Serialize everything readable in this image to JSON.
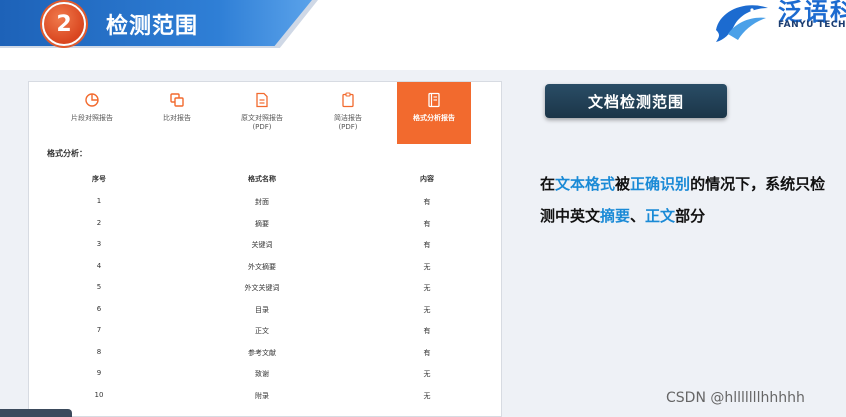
{
  "header": {
    "number": "2",
    "title": "检测范围"
  },
  "logo": {
    "cn": "泛语科",
    "en": "FANYU TECHNOL"
  },
  "tabs": [
    {
      "label": "片段对照报告",
      "icon": "pie-chart-icon"
    },
    {
      "label": "比对报告",
      "icon": "copy-icon"
    },
    {
      "label": "原文对照报告\n(PDF)",
      "icon": "document-icon"
    },
    {
      "label": "简洁报告\n(PDF)",
      "icon": "clipboard-icon"
    },
    {
      "label": "格式分析报告",
      "icon": "book-icon",
      "active": true
    }
  ],
  "section_label": "格式分析：",
  "table": {
    "headers": [
      "序号",
      "格式名称",
      "内容"
    ],
    "rows": [
      [
        "1",
        "封面",
        "有"
      ],
      [
        "2",
        "摘要",
        "有"
      ],
      [
        "3",
        "关键词",
        "有"
      ],
      [
        "4",
        "外文摘要",
        "无"
      ],
      [
        "5",
        "外文关键词",
        "无"
      ],
      [
        "6",
        "目录",
        "无"
      ],
      [
        "7",
        "正文",
        "有"
      ],
      [
        "8",
        "参考文献",
        "有"
      ],
      [
        "9",
        "致谢",
        "无"
      ],
      [
        "10",
        "附录",
        "无"
      ]
    ]
  },
  "right": {
    "pill": "文档检测范围",
    "desc": [
      {
        "t": "在",
        "h": false
      },
      {
        "t": "文本格式",
        "h": true
      },
      {
        "t": "被",
        "h": false
      },
      {
        "t": "正确识别",
        "h": true
      },
      {
        "t": "的情况下，系统只检测中英文",
        "h": false
      },
      {
        "t": "摘要",
        "h": true
      },
      {
        "t": "、",
        "h": false
      },
      {
        "t": "正文",
        "h": true
      },
      {
        "t": "部分",
        "h": false
      }
    ]
  },
  "watermark": "CSDN @hlllllllhhhhh",
  "colors": {
    "banner": "#2f7fd6",
    "badge": "#d9461f",
    "active_tab": "#f26a2e",
    "highlight": "#1a8ad6",
    "pill": "#1b3548"
  }
}
